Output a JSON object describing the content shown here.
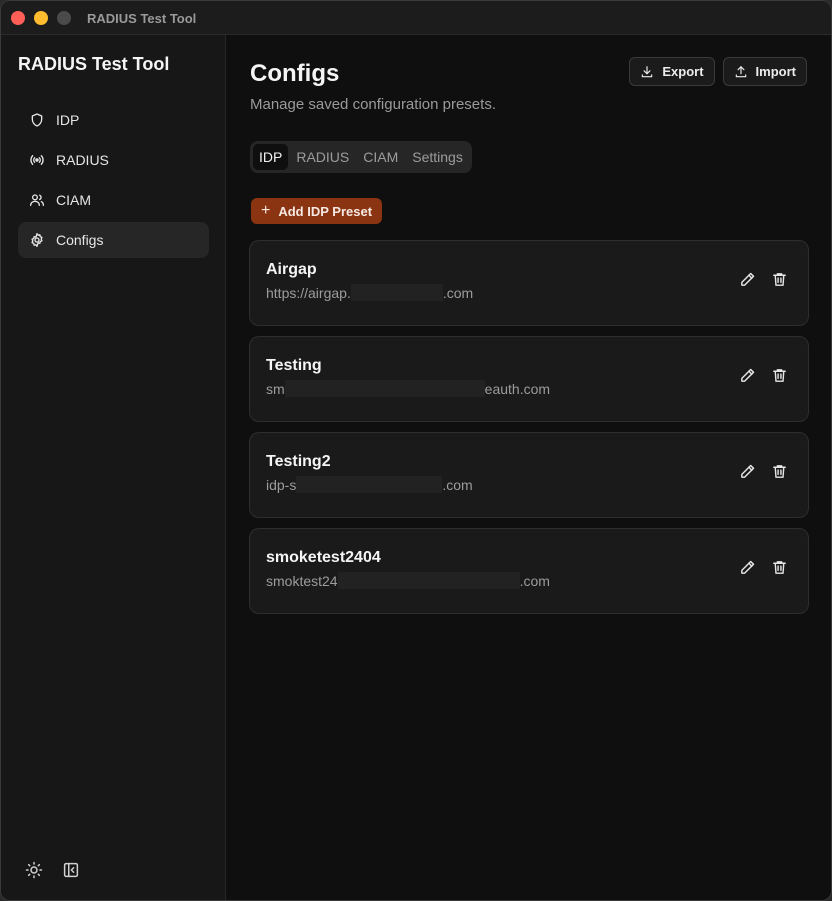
{
  "window": {
    "title": "RADIUS Test Tool"
  },
  "sidebar": {
    "app_name": "RADIUS Test Tool",
    "items": [
      {
        "label": "IDP",
        "icon": "shield-icon",
        "active": false
      },
      {
        "label": "RADIUS",
        "icon": "broadcast-icon",
        "active": false
      },
      {
        "label": "CIAM",
        "icon": "users-icon",
        "active": false
      },
      {
        "label": "Configs",
        "icon": "gear-icon",
        "active": true
      }
    ],
    "footer": {
      "theme_icon": "sun-icon",
      "collapse_icon": "collapse-sidebar-icon"
    }
  },
  "main": {
    "title": "Configs",
    "subtitle": "Manage saved configuration presets.",
    "export_label": "Export",
    "import_label": "Import",
    "tabs": [
      {
        "label": "IDP",
        "active": true
      },
      {
        "label": "RADIUS",
        "active": false
      },
      {
        "label": "CIAM",
        "active": false
      },
      {
        "label": "Settings",
        "active": false
      }
    ],
    "add_button": {
      "icon": "+",
      "label": "Add IDP Preset"
    },
    "presets": [
      {
        "name": "Airgap",
        "url_prefix": "https://airgap.",
        "url_suffix": ".com"
      },
      {
        "name": "Testing",
        "url_prefix": "sm",
        "url_suffix": "eauth.com"
      },
      {
        "name": "Testing2",
        "url_prefix": "idp-s",
        "url_suffix": ".com"
      },
      {
        "name": "smoketest2404",
        "url_prefix": "smoktest24",
        "url_suffix": ".com"
      }
    ]
  },
  "colors": {
    "accent": "#8a3412",
    "background": "#0f0f0f",
    "sidebar": "#171717",
    "card": "#1a1a1a"
  }
}
